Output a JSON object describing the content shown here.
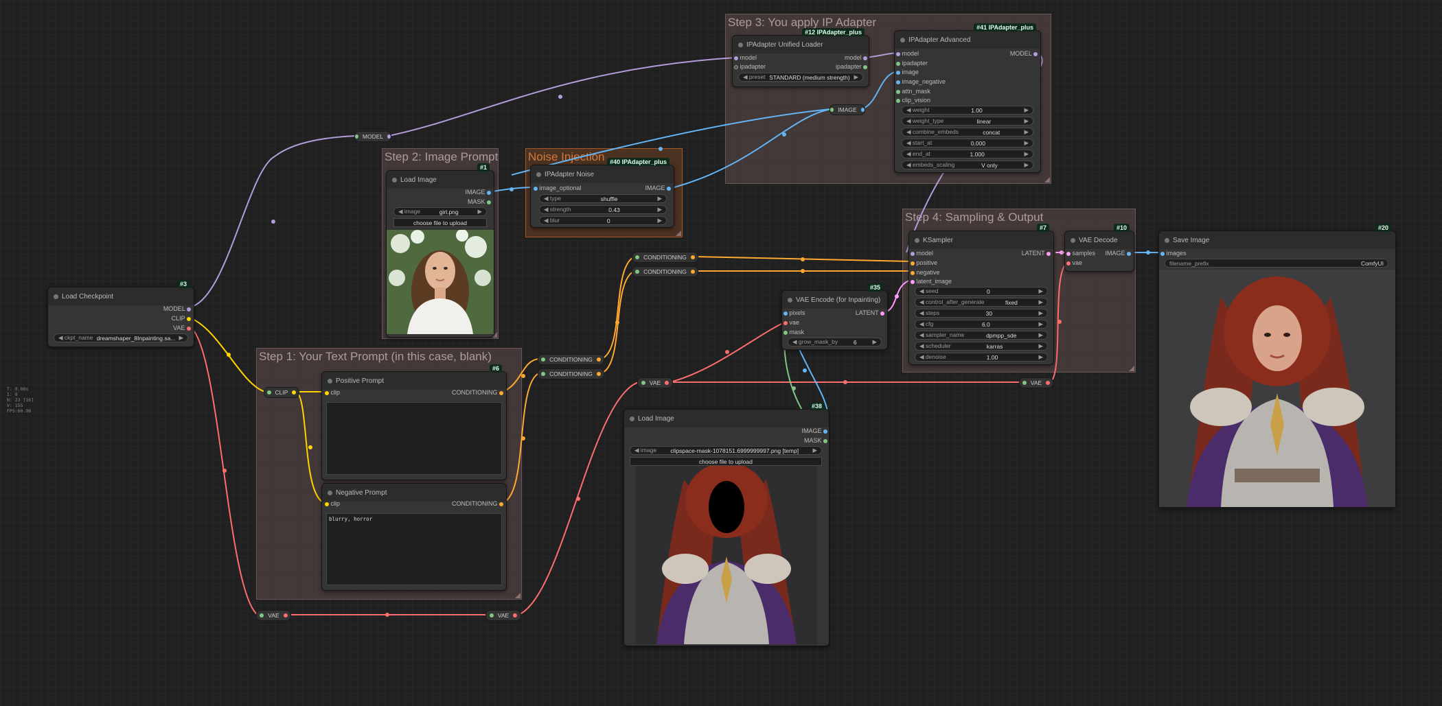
{
  "stats": [
    "T: 0.00s",
    "I: 0",
    "N: 23 [16]",
    "V: 155",
    "FPS:60.98"
  ],
  "groups": {
    "step1": "Step 1: Your Text Prompt (in this case, blank)",
    "step2": "Step 2: Image Prompt",
    "noise": "Noise Injection",
    "step3": "Step 3: You apply IP Adapter",
    "step4": "Step 4: Sampling & Output"
  },
  "reroutes": {
    "model": "MODEL",
    "clip": "CLIP",
    "vae_bottom_left": "VAE",
    "vae_bottom_right": "VAE",
    "vae_mid": "VAE",
    "vae_right": "VAE",
    "image": "IMAGE",
    "cond_a": "CONDITIONING",
    "cond_b": "CONDITIONING",
    "cond_c": "CONDITIONING",
    "cond_d": "CONDITIONING"
  },
  "load_checkpoint": {
    "title": "Load Checkpoint",
    "badge": "#3",
    "outputs": [
      "MODEL",
      "CLIP",
      "VAE"
    ],
    "widget_label": "ckpt_name",
    "widget_value": "dreamshaper_8Inpainting.sa..."
  },
  "positive_prompt": {
    "title": "Positive Prompt",
    "badge": "#6",
    "input": "clip",
    "output": "CONDITIONING",
    "text": ""
  },
  "negative_prompt": {
    "title": "Negative Prompt",
    "input": "clip",
    "output": "CONDITIONING",
    "text": "blurry, horror"
  },
  "load_image_1": {
    "title": "Load Image",
    "badge": "#1",
    "outputs": [
      "IMAGE",
      "MASK"
    ],
    "widget_label": "image",
    "widget_value": "girl.png",
    "upload": "choose file to upload"
  },
  "ipadapter_noise": {
    "title": "IPAdapter Noise",
    "badge": "#40 IPAdapter_plus",
    "input": "image_optional",
    "output": "IMAGE",
    "widgets": [
      {
        "label": "type",
        "value": "shuffle"
      },
      {
        "label": "strength",
        "value": "0.43"
      },
      {
        "label": "blur",
        "value": "0"
      }
    ]
  },
  "unified_loader": {
    "title": "IPAdapter Unified Loader",
    "badge": "#12 IPAdapter_plus",
    "inputs": [
      "model",
      "ipadapter"
    ],
    "outputs": [
      "model",
      "ipadapter"
    ],
    "widget_label": "preset",
    "widget_value": "STANDARD (medium strength)"
  },
  "ipadapter_advanced": {
    "title": "IPAdapter Advanced",
    "badge": "#41 IPAdapter_plus",
    "inputs": [
      "model",
      "ipadapter",
      "image",
      "image_negative",
      "attn_mask",
      "clip_vision"
    ],
    "output": "MODEL",
    "widgets": [
      {
        "label": "weight",
        "value": "1.00"
      },
      {
        "label": "weight_type",
        "value": "linear"
      },
      {
        "label": "combine_embeds",
        "value": "concat"
      },
      {
        "label": "start_at",
        "value": "0.000"
      },
      {
        "label": "end_at",
        "value": "1.000"
      },
      {
        "label": "embeds_scaling",
        "value": "V only"
      }
    ]
  },
  "ksampler": {
    "title": "KSampler",
    "badge": "#7",
    "inputs": [
      "model",
      "positive",
      "negative",
      "latent_image"
    ],
    "output": "LATENT",
    "widgets": [
      {
        "label": "seed",
        "value": "0"
      },
      {
        "label": "control_after_generate",
        "value": "fixed"
      },
      {
        "label": "steps",
        "value": "30"
      },
      {
        "label": "cfg",
        "value": "6.0"
      },
      {
        "label": "sampler_name",
        "value": "dpmpp_sde"
      },
      {
        "label": "scheduler",
        "value": "karras"
      },
      {
        "label": "denoise",
        "value": "1.00"
      }
    ]
  },
  "vae_decode": {
    "title": "VAE Decode",
    "badge": "#10",
    "inputs": [
      "samples",
      "vae"
    ],
    "output": "IMAGE"
  },
  "save_image": {
    "title": "Save Image",
    "badge": "#20",
    "input": "images",
    "widget_label": "filename_prefix",
    "widget_value": "ComfyUI"
  },
  "vae_encode": {
    "title": "VAE Encode (for Inpainting)",
    "badge": "#35",
    "inputs": [
      "pixels",
      "vae",
      "mask"
    ],
    "output": "LATENT",
    "widget_label": "grow_mask_by",
    "widget_value": "6"
  },
  "load_image_2": {
    "title": "Load Image",
    "badge": "#38",
    "outputs": [
      "IMAGE",
      "MASK"
    ],
    "widget_label": "image",
    "widget_value": "clipspace-mask-1078151.6999999997.png [temp]",
    "upload": "choose file to upload"
  },
  "colors": {
    "model": "#b39ddb",
    "clip": "#ffd500",
    "vae": "#ff6e6e",
    "image": "#64b5f6",
    "conditioning": "#ffa931",
    "latent": "#ff9cf9",
    "mask": "#81c784"
  }
}
